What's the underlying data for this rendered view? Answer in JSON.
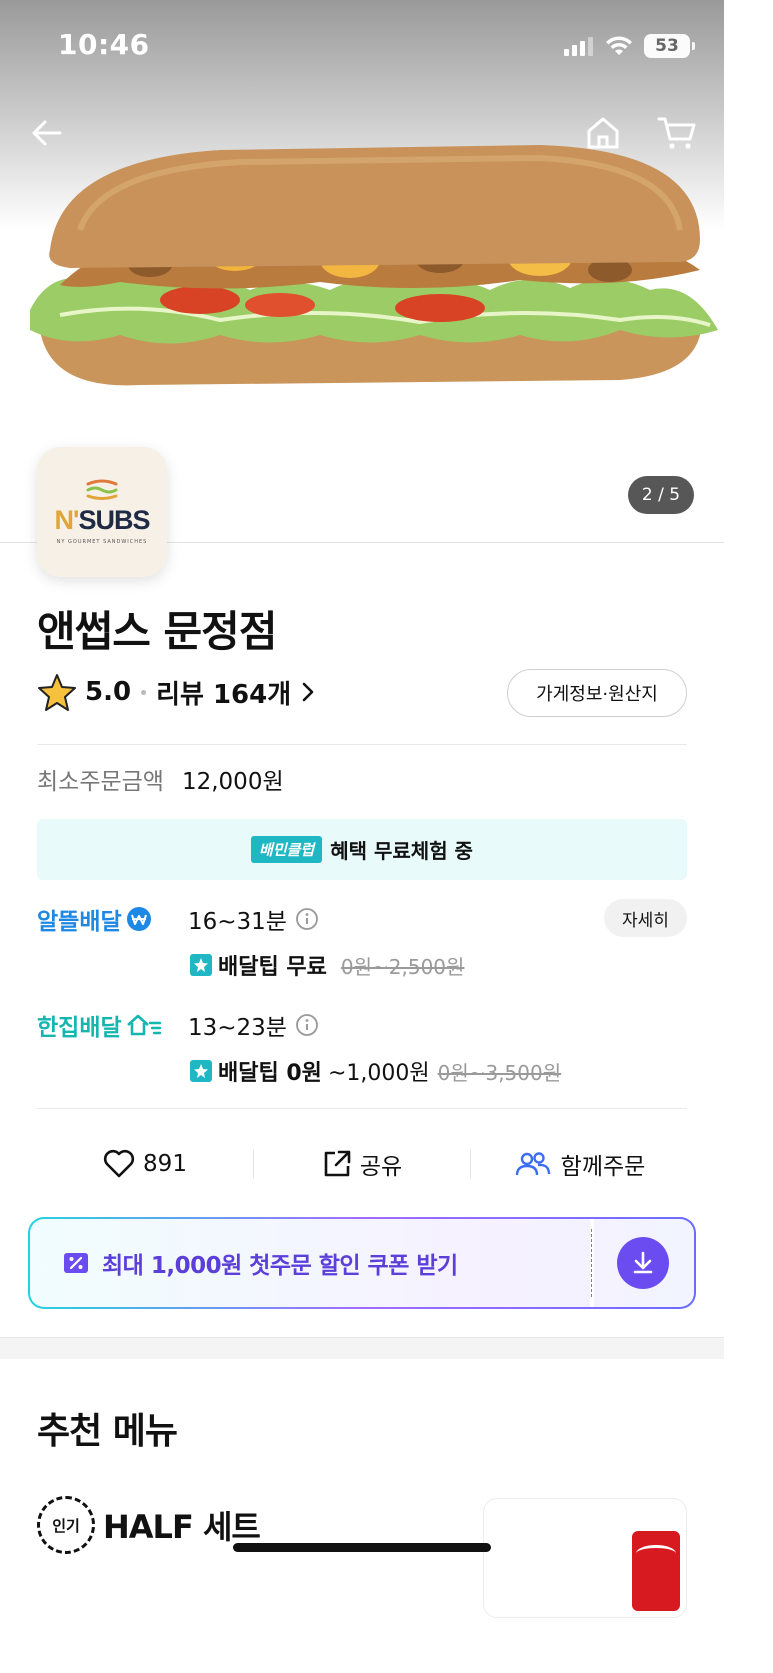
{
  "status_bar": {
    "time": "10:46",
    "battery": "53"
  },
  "hero": {
    "page_indicator": "2 / 5"
  },
  "logo": {
    "brand": "N'SUBS",
    "brand_n": "N'",
    "brand_rest": "SUBS",
    "tagline": "NY GOURMET SANDWICHES"
  },
  "store": {
    "name": "앤썹스 문정점",
    "rating": "5.0",
    "reviews": "리뷰 164개",
    "info_button": "가게정보·원산지"
  },
  "min_order": {
    "label": "최소주문금액",
    "value": "12,000원"
  },
  "club_banner": {
    "badge": "배민클럽",
    "text": "혜택 무료체험 중"
  },
  "delivery": [
    {
      "type": "알뜰배달",
      "time": "16~31분",
      "fee_bold": "배달팁 무료",
      "fee_rest": "",
      "fee_strike": "0원~2,500원",
      "color": "#1e88e5"
    },
    {
      "type": "한집배달",
      "time": "13~23분",
      "fee_bold": "배달팁 0원",
      "fee_rest": "~1,000원",
      "fee_strike": "0원~3,500원",
      "color": "#16b6b0"
    }
  ],
  "detail_button": "자세히",
  "actions": {
    "likes": "891",
    "share": "공유",
    "group_order": "함께주문"
  },
  "coupon": {
    "text": "최대 1,000원 첫주문 할인 쿠폰 받기",
    "accent": "#6b4cf0"
  },
  "recommended": {
    "title": "추천 메뉴",
    "badge": "인기",
    "item_name": "HALF 세트"
  }
}
